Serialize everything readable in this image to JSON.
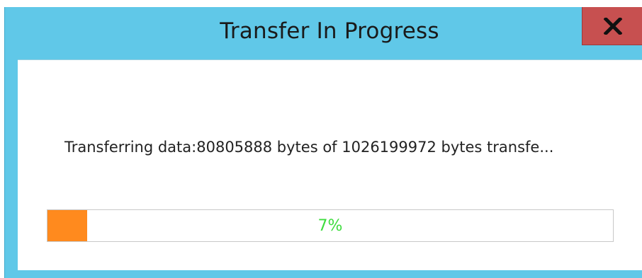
{
  "window": {
    "title": "Transfer In Progress",
    "frame_color": "#60c8e8",
    "close_button": {
      "icon": "close-icon",
      "color": "#c75050"
    }
  },
  "status_text": "Transferring data:80805888 bytes of 1026199972 bytes transfe...",
  "progress": {
    "percent": 7,
    "label": "7%",
    "fill_color": "#ff8a1e",
    "label_color": "#3ddc3d"
  }
}
